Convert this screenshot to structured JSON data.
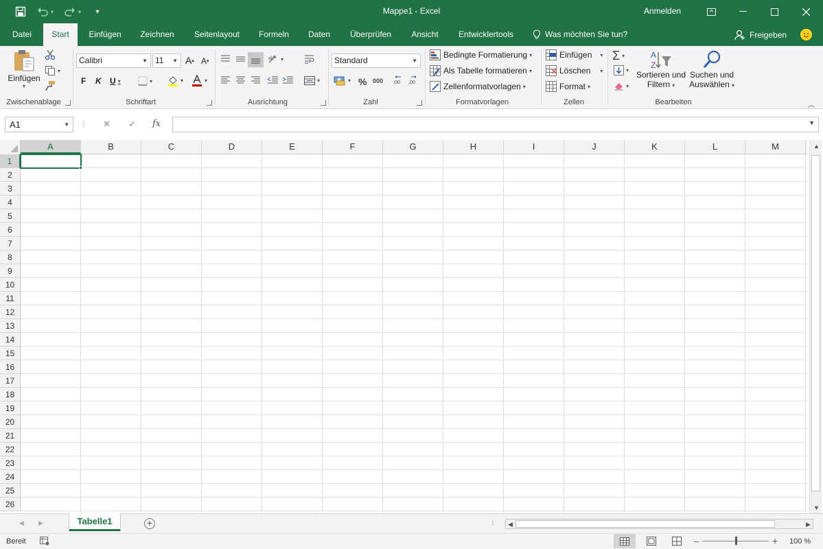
{
  "titlebar": {
    "title": "Mappe1  -  Excel",
    "signin": "Anmelden",
    "icons": [
      "save-icon",
      "undo-icon",
      "redo-icon",
      "customize-qat-icon",
      "ribbon-display-icon",
      "minimize-icon",
      "maximize-icon",
      "close-icon"
    ]
  },
  "tabs": [
    {
      "label": "Datei"
    },
    {
      "label": "Start"
    },
    {
      "label": "Einfügen"
    },
    {
      "label": "Zeichnen"
    },
    {
      "label": "Seitenlayout"
    },
    {
      "label": "Formeln"
    },
    {
      "label": "Daten"
    },
    {
      "label": "Überprüfen"
    },
    {
      "label": "Ansicht"
    },
    {
      "label": "Entwicklertools"
    }
  ],
  "active_tab": "Start",
  "tellme": "Was möchten Sie tun?",
  "share": "Freigeben",
  "ribbon": {
    "clipboard": {
      "paste_label": "Einfügen",
      "group": "Zwischenablage"
    },
    "font": {
      "name": "Calibri",
      "size": "11",
      "bold": "F",
      "italic": "K",
      "underline": "U",
      "grow": "A",
      "shrink": "A",
      "group": "Schriftart",
      "highlight_color": "#ffff00",
      "font_color": "#c00000"
    },
    "alignment": {
      "group": "Ausrichtung"
    },
    "number": {
      "format": "Standard",
      "percent": "%",
      "thousands": "000",
      "group": "Zahl"
    },
    "styles": {
      "conditional": "Bedingte Formatierung",
      "as_table": "Als Tabelle formatieren",
      "cell_styles": "Zellenformatvorlagen",
      "group": "Formatvorlagen"
    },
    "cells": {
      "insert": "Einfügen",
      "delete": "Löschen",
      "format": "Format",
      "group": "Zellen"
    },
    "editing": {
      "sort_line1": "Sortieren und",
      "sort_line2": "Filtern",
      "find_line1": "Suchen und",
      "find_line2": "Auswählen",
      "group": "Bearbeiten"
    }
  },
  "formula_bar": {
    "name_box": "A1",
    "cancel": "✕",
    "enter": "✓",
    "fx": "fx",
    "value": ""
  },
  "grid": {
    "columns": [
      "A",
      "B",
      "C",
      "D",
      "E",
      "F",
      "G",
      "H",
      "I",
      "J",
      "K",
      "L",
      "M"
    ],
    "rows": [
      "1",
      "2",
      "3",
      "4",
      "5",
      "6",
      "7",
      "8",
      "9",
      "10",
      "11",
      "12",
      "13",
      "14",
      "15",
      "16",
      "17",
      "18",
      "19",
      "20",
      "21",
      "22",
      "23",
      "24",
      "25",
      "26"
    ],
    "active_column": "A",
    "active_row": "1"
  },
  "sheets": {
    "active": "Tabelle1",
    "add": "+"
  },
  "status": {
    "ready": "Bereit",
    "zoom": "100 %",
    "zoom_level": 100,
    "minus": "–",
    "plus": "+"
  },
  "colors": {
    "accent": "#217346",
    "ribbon_bg": "#f3f3f3"
  }
}
